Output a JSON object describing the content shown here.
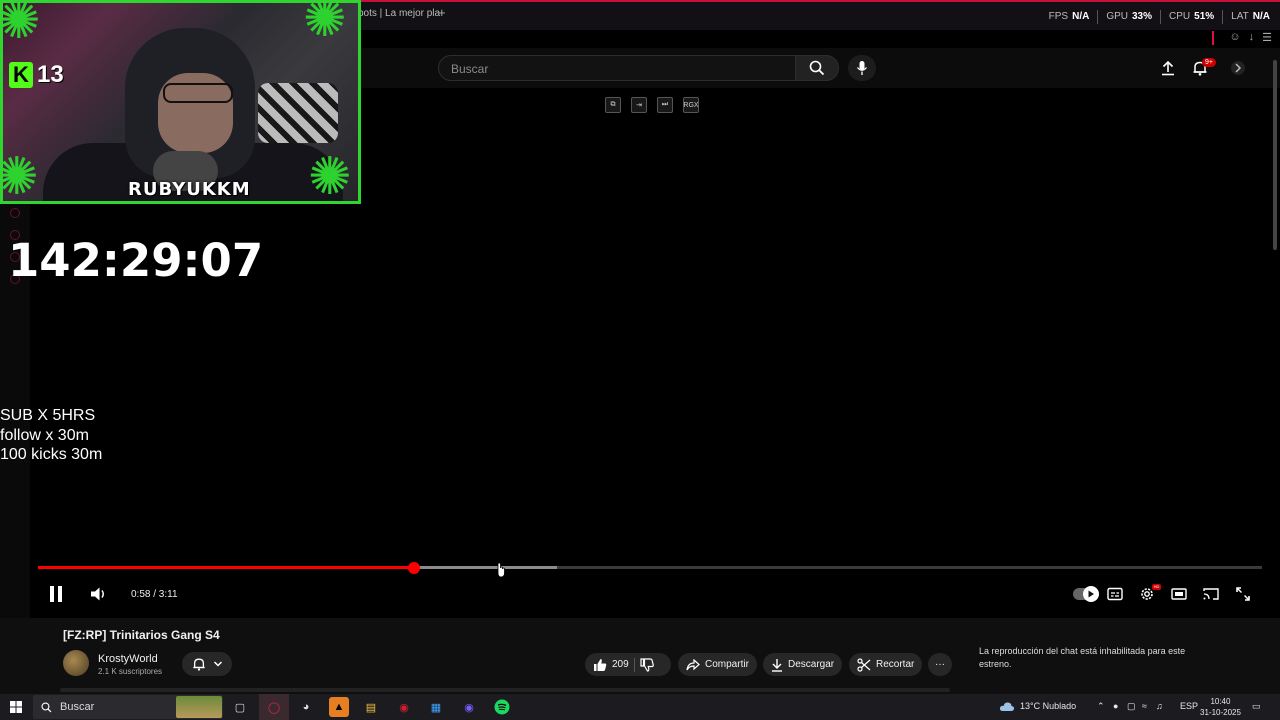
{
  "browser": {
    "tab_text": "bots | La mejor pla",
    "new_tab": "+",
    "stats": [
      {
        "label": "FPS",
        "value": "N/A"
      },
      {
        "label": "GPU",
        "value": "33%"
      },
      {
        "label": "CPU",
        "value": "51%"
      },
      {
        "label": "LAT",
        "value": "N/A"
      }
    ]
  },
  "header": {
    "search_placeholder": "Buscar",
    "notif_badge": "9+"
  },
  "overlay": {
    "kick_letter": "K",
    "kick_count": "13",
    "streamer_name": "RUBYUKKM",
    "timer": "142:29:07",
    "sub_lines": [
      "SUB X 5HRS",
      "follow x 30m",
      "100 kicks 30m"
    ],
    "rgx_label": "RGX"
  },
  "player": {
    "time_display": "0:58 / 3:11",
    "progress_fraction": 0.307,
    "buffered_fraction": 0.424,
    "hd_label": "HD"
  },
  "video": {
    "title": "[FZ:RP] Trinitarios Gang S4",
    "channel": "KrostyWorld",
    "subscribers": "2.1 K suscriptores",
    "likes": "209",
    "share_label": "Compartir",
    "download_label": "Descargar",
    "clip_label": "Recortar",
    "more_label": "···",
    "chat_disabled": "La reproducción del chat está inhabilitada para este estreno."
  },
  "taskbar": {
    "search_label": "Buscar",
    "weather": "13°C  Nublado",
    "lang": "ESP",
    "time": "10:40",
    "date": "31-10-2025"
  },
  "colors": {
    "accent_red": "#ff0000",
    "gx_red": "#c9103a",
    "cam_border": "#2fd62f",
    "kick_green": "#53fc18"
  }
}
